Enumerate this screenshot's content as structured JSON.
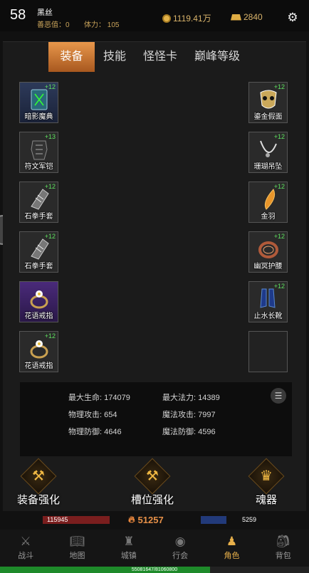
{
  "player": {
    "level": "58",
    "name": "黑丝",
    "shan_e": "善恶值：0",
    "stamina": "体力： 105",
    "coins": "1119.41万",
    "gold": "2840"
  },
  "tabs": [
    "装备",
    "技能",
    "怪怪卡",
    "巅峰等级"
  ],
  "equipment_left": [
    {
      "name": "暗影魔典",
      "plus": "+12",
      "icon": "book-icon"
    },
    {
      "name": "符文军铠",
      "plus": "+13",
      "icon": "armor-icon"
    },
    {
      "name": "石拳手套",
      "plus": "+12",
      "icon": "gauntlet-icon"
    },
    {
      "name": "石拳手套",
      "plus": "+12",
      "icon": "gauntlet-icon"
    },
    {
      "name": "花语戒指",
      "plus": "",
      "icon": "ring-icon"
    },
    {
      "name": "花语戒指",
      "plus": "+12",
      "icon": "ring-icon"
    }
  ],
  "equipment_right": [
    {
      "name": "鎏金假面",
      "plus": "+12",
      "icon": "mask-icon"
    },
    {
      "name": "珊瑚吊坠",
      "plus": "+12",
      "icon": "pendant-icon"
    },
    {
      "name": "金羽",
      "plus": "+12",
      "icon": "feather-icon"
    },
    {
      "name": "幽冥护腰",
      "plus": "+12",
      "icon": "belt-icon"
    },
    {
      "name": "止水长靴",
      "plus": "+12",
      "icon": "boots-icon"
    },
    {
      "name": "",
      "plus": "",
      "icon": "empty-slot"
    }
  ],
  "stats": {
    "max_hp": "最大生命: 174079",
    "max_mp": "最大法力: 14389",
    "phys_atk": "物理攻击: 654",
    "magic_atk": "魔法攻击: 7997",
    "phys_def": "物理防御: 4646",
    "magic_def": "魔法防御: 4596"
  },
  "actions": {
    "enhance": "装备强化",
    "slot_enhance": "槽位强化",
    "soul": "魂器"
  },
  "bars": {
    "hp": "115945",
    "power": "51257",
    "mp": "5259",
    "exp_text": "55081647/81060800",
    "exp_fraction": 0.6795
  },
  "nav": [
    "战斗",
    "地图",
    "城镇",
    "行会",
    "角色",
    "背包"
  ],
  "colors": {
    "accent": "#e8974b",
    "plus_green": "#5fe05f",
    "nav_active": "#e8b04a"
  }
}
